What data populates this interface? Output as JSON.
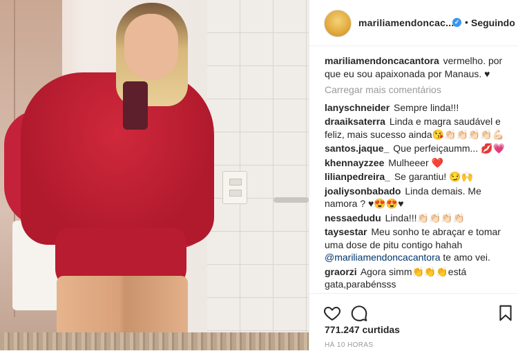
{
  "post": {
    "author": "mariliamendoncacantora",
    "author_short": "mariliamendoncac...",
    "verified": true,
    "follow_label": "Seguindo",
    "separator": "•",
    "load_more": "Carregar mais comentários",
    "caption": {
      "user": "mariliamendoncacantora",
      "text": "vermelho. por que eu sou apaixonada por Manaus. ♥"
    },
    "comments": [
      {
        "user": "lanyschneider",
        "text": "Sempre linda!!!"
      },
      {
        "user": "draaiksaterra",
        "text": "Linda e magra saudável e feliz, mais sucesso ainda😘👏🏻👏🏻👏🏻👏🏻💪🏻"
      },
      {
        "user": "santos.jaque_",
        "text": "Que perfeiçaumm... 💋💗"
      },
      {
        "user": "khennayzzee",
        "text": "Mulheeer ❤️"
      },
      {
        "user": "lilianpedreira_",
        "text": "Se garantiu! 😏🙌"
      },
      {
        "user": "joaliysonbabado",
        "text": "Linda demais. Me namora ? ♥😍😍♥"
      },
      {
        "user": "nessaedudu",
        "text": "Linda!!!👏🏻👏🏻👏🏻👏🏻"
      },
      {
        "user": "taysestar",
        "text": "Meu sonho te abraçar e tomar uma dose de pitu contigo hahah",
        "mention": "@mariliamendoncacantora",
        "after": "te amo vei."
      },
      {
        "user": "graorzi",
        "text": "Agora simm👏👏👏está gata,parabénsss"
      }
    ],
    "likes": "771.247 curtidas",
    "time": "HÁ 10 HORAS"
  },
  "icons": {
    "like": "heart-icon",
    "comment": "comment-icon",
    "save": "bookmark-icon",
    "verified": "verified-badge-icon"
  },
  "colors": {
    "verified": "#3897f0",
    "muted": "#999999",
    "mention": "#003569"
  }
}
